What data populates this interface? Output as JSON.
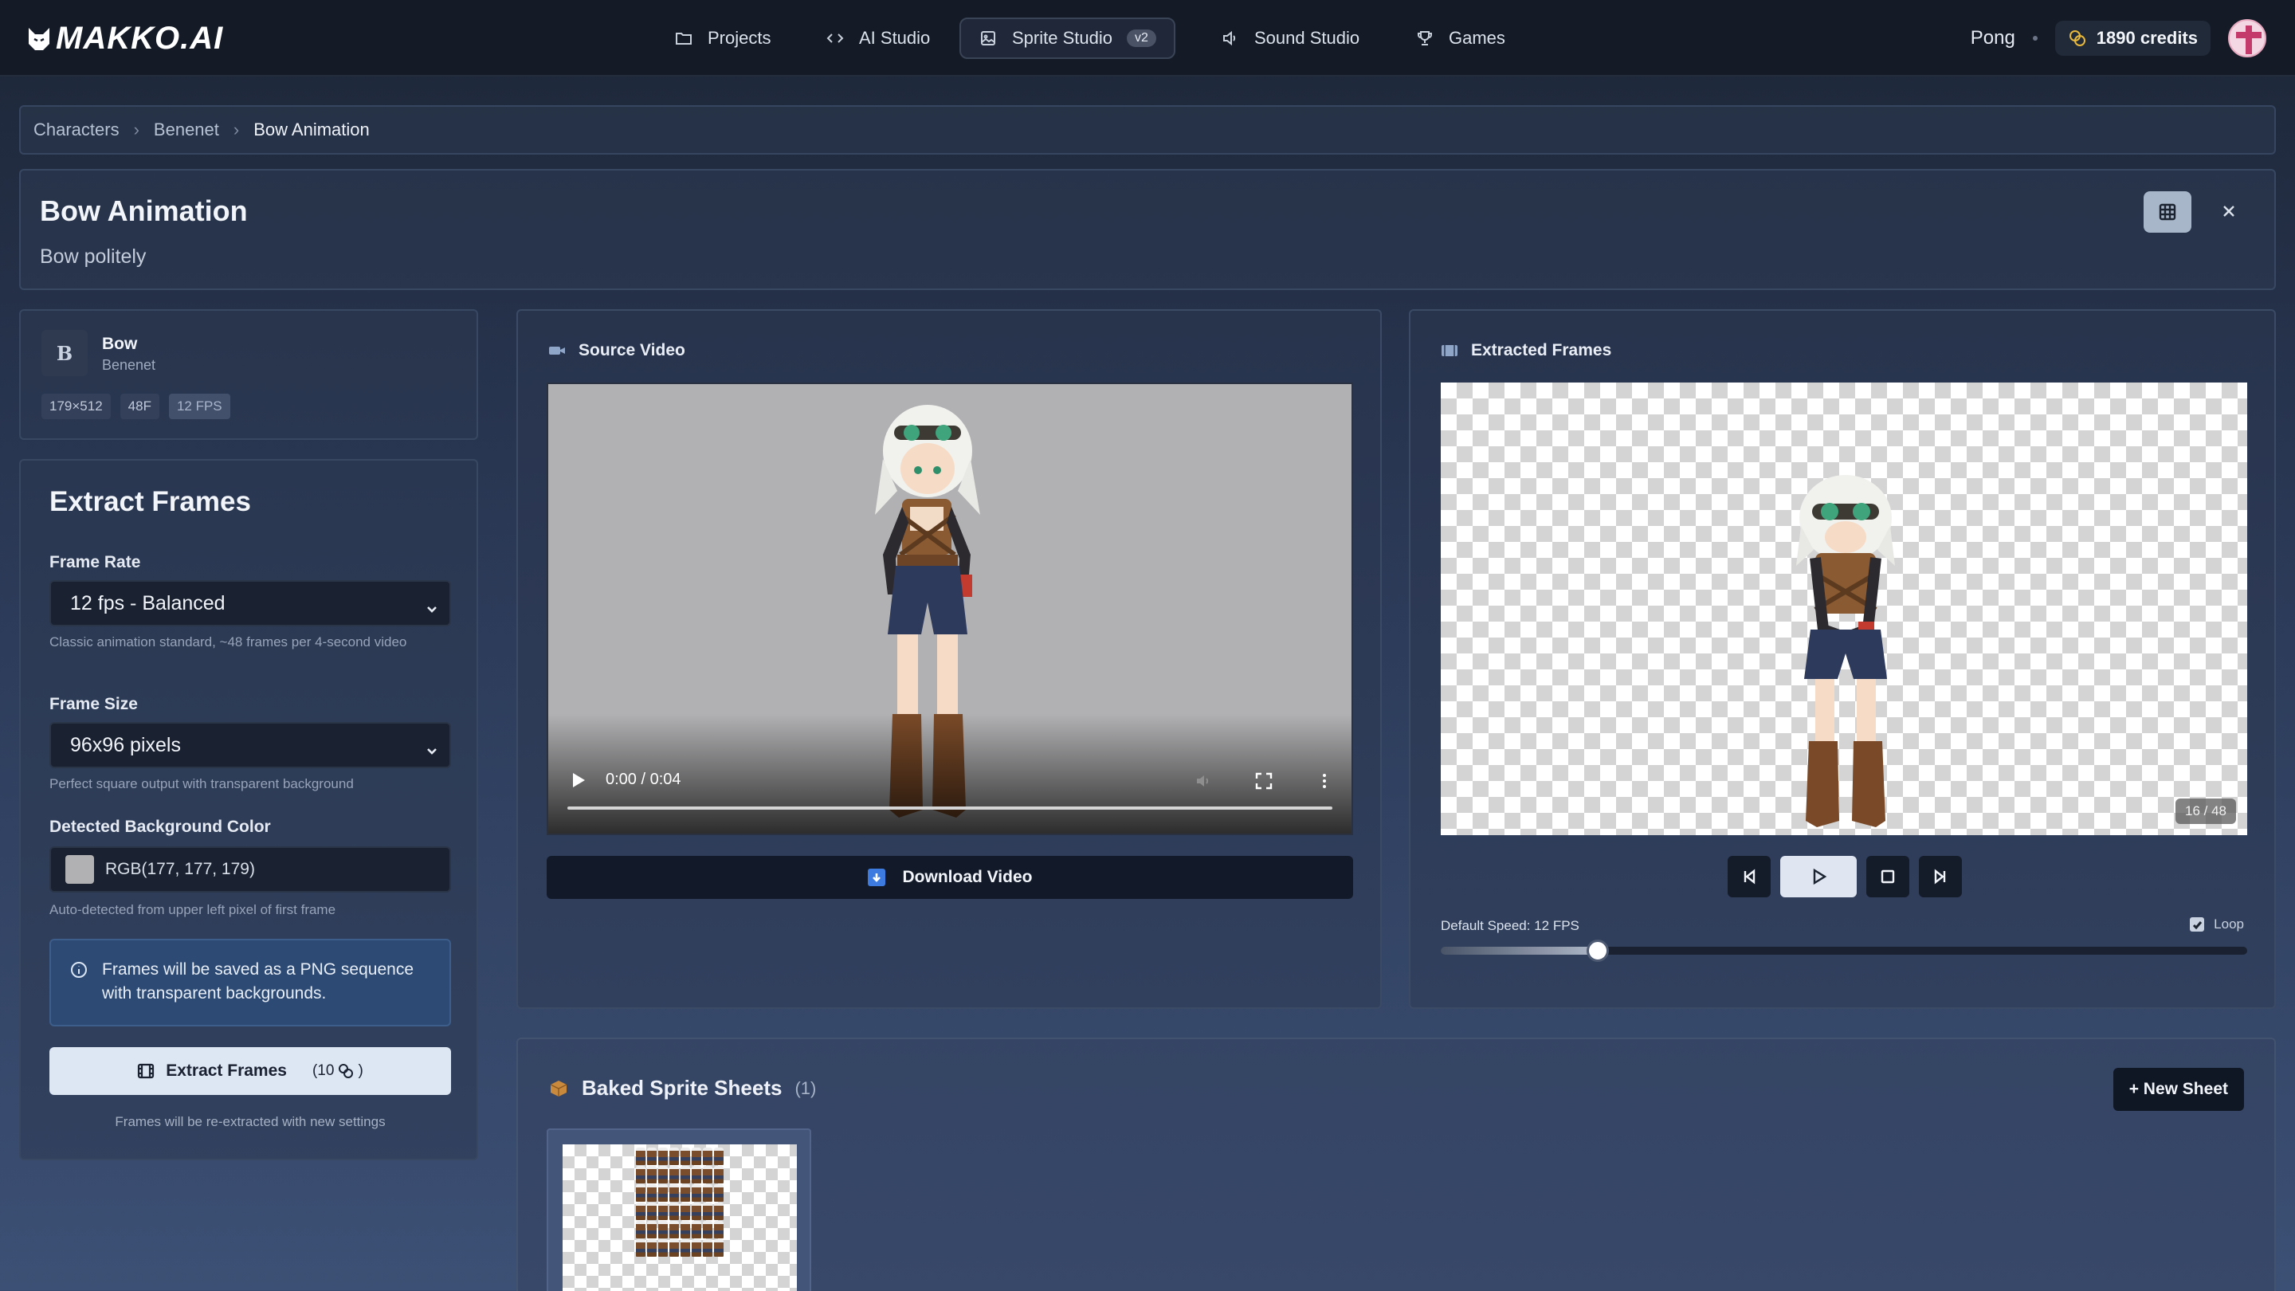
{
  "app": {
    "logo_text": "MAKKO.AI"
  },
  "nav": {
    "items": [
      {
        "label": "Projects",
        "icon": "folder-icon"
      },
      {
        "label": "AI Studio",
        "icon": "code-icon"
      },
      {
        "label": "Sprite Studio",
        "icon": "image-icon",
        "badge": "v2",
        "active": true
      },
      {
        "label": "Sound Studio",
        "icon": "speaker-icon"
      },
      {
        "label": "Games",
        "icon": "trophy-icon"
      }
    ],
    "project": "Pong",
    "credits": "1890 credits"
  },
  "breadcrumb": [
    "Characters",
    "Benenet",
    "Bow Animation"
  ],
  "header": {
    "title": "Bow Animation",
    "subtitle": "Bow politely"
  },
  "animation": {
    "letter": "B",
    "name": "Bow",
    "character": "Benenet",
    "tags": [
      "179×512",
      "48F",
      "12 FPS"
    ]
  },
  "extract": {
    "title": "Extract Frames",
    "frame_rate_label": "Frame Rate",
    "frame_rate_value": "12 fps - Balanced",
    "frame_rate_hint": "Classic animation standard, ~48 frames per 4-second video",
    "frame_size_label": "Frame Size",
    "frame_size_value": "96x96 pixels",
    "frame_size_hint": "Perfect square output with transparent background",
    "bg_label": "Detected Background Color",
    "bg_value": "RGB(177, 177, 179)",
    "bg_color": "#b1b1b3",
    "bg_hint": "Auto-detected from upper left pixel of first frame",
    "info": "Frames will be saved as a PNG sequence with transparent backgrounds.",
    "button_label": "Extract Frames",
    "button_cost_prefix": "(10",
    "button_cost_suffix": ")",
    "footer_hint": "Frames will be re-extracted with new settings"
  },
  "source_video": {
    "title": "Source Video",
    "time": "0:00 / 0:04",
    "download_label": "Download Video"
  },
  "extracted": {
    "title": "Extracted Frames",
    "counter": "16 / 48",
    "speed_label": "Default Speed: 12 FPS",
    "loop_label": "Loop",
    "loop_checked": true,
    "speed_fraction": 0.195
  },
  "sheets": {
    "title": "Baked Sprite Sheets",
    "count": "(1)",
    "new_label": "+ New Sheet"
  },
  "colors": {
    "accent_blue": "#3d7be0",
    "nav_bg": "#151b26"
  }
}
